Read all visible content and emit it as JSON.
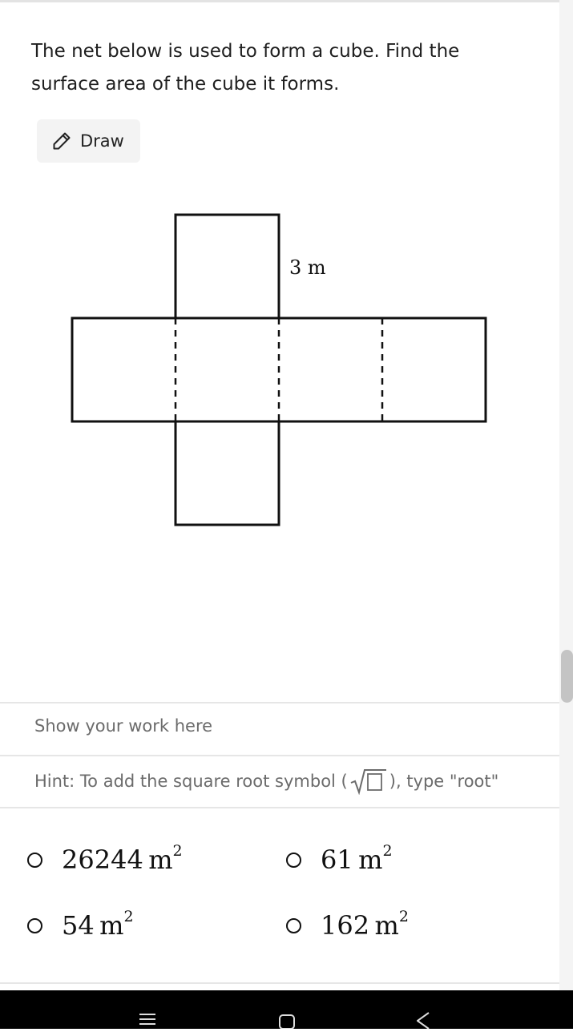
{
  "question": {
    "line1": "The net below is used to form a cube. Find the",
    "line2": "surface area of the cube it forms."
  },
  "draw_button": {
    "label": "Draw",
    "icon": "pencil-icon"
  },
  "figure": {
    "dimension_label": "3 m"
  },
  "work_area": {
    "placeholder": "Show your work here"
  },
  "hint": {
    "prefix": "Hint: To add the square root symbol (",
    "suffix": "), type \"root\""
  },
  "options": [
    {
      "value": "26244",
      "unit": "m",
      "exponent": "2"
    },
    {
      "value": "61",
      "unit": "m",
      "exponent": "2"
    },
    {
      "value": "54",
      "unit": "m",
      "exponent": "2"
    },
    {
      "value": "162",
      "unit": "m",
      "exponent": "2"
    }
  ],
  "nav": {
    "icons": [
      "menu-icon",
      "home-icon",
      "back-icon"
    ]
  }
}
